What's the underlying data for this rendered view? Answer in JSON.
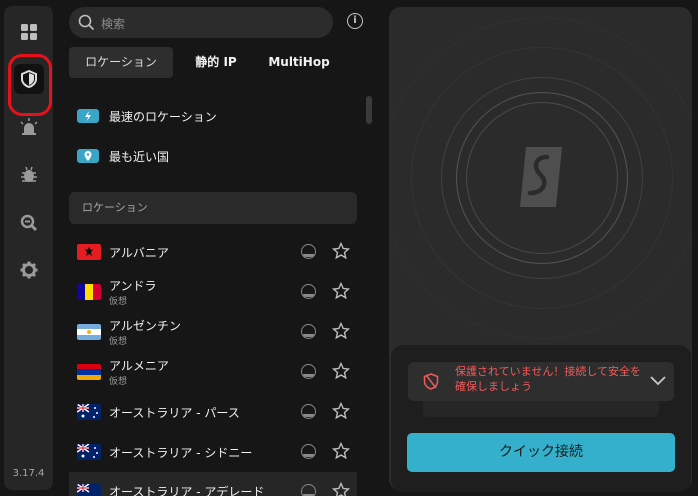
{
  "app": {
    "version": "3.17.4"
  },
  "rail": {
    "items": [
      {
        "icon": "grid-icon"
      },
      {
        "icon": "shield-icon",
        "active": true
      },
      {
        "icon": "alert-icon"
      },
      {
        "icon": "bug-icon"
      },
      {
        "icon": "search-bug-icon"
      },
      {
        "icon": "gear-icon"
      }
    ]
  },
  "search": {
    "placeholder": "検索"
  },
  "tabs": [
    {
      "label": "ロケーション",
      "active": true
    },
    {
      "label": "静的 IP"
    },
    {
      "label": "MultiHop"
    }
  ],
  "quick_options": [
    {
      "label": "最速のロケーション",
      "icon": "lightning-icon"
    },
    {
      "label": "最も近い国",
      "icon": "pin-icon"
    }
  ],
  "locations_section": {
    "title": "ロケーション"
  },
  "locations": [
    {
      "name": "アルバニア",
      "sub": ""
    },
    {
      "name": "アンドラ",
      "sub": "仮想"
    },
    {
      "name": "アルゼンチン",
      "sub": "仮想"
    },
    {
      "name": "アルメニア",
      "sub": "仮想"
    },
    {
      "name": "オーストラリア - パース",
      "sub": ""
    },
    {
      "name": "オーストラリア - シドニー",
      "sub": ""
    },
    {
      "name": "オーストラリア - アデレード",
      "sub": ""
    }
  ],
  "status": {
    "message": "保護されていません！接続して安全を確保しましょう",
    "color": "#f25a5a"
  },
  "connect": {
    "label": "クイック接続",
    "color": "#34b0cc"
  }
}
